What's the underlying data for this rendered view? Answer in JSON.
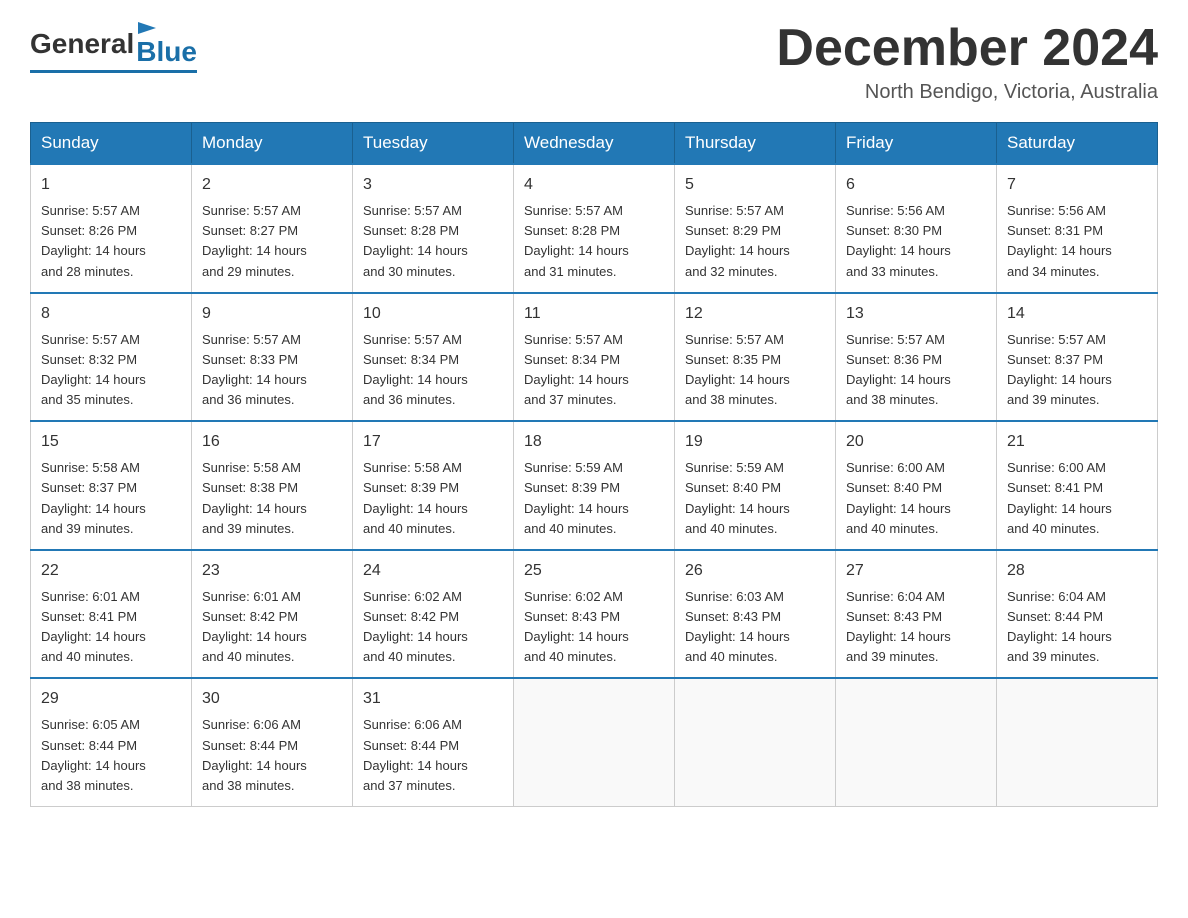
{
  "header": {
    "logo_general": "General",
    "logo_blue": "Blue",
    "month_title": "December 2024",
    "location": "North Bendigo, Victoria, Australia"
  },
  "weekdays": [
    "Sunday",
    "Monday",
    "Tuesday",
    "Wednesday",
    "Thursday",
    "Friday",
    "Saturday"
  ],
  "weeks": [
    [
      {
        "day": "1",
        "sunrise": "5:57 AM",
        "sunset": "8:26 PM",
        "daylight": "14 hours and 28 minutes."
      },
      {
        "day": "2",
        "sunrise": "5:57 AM",
        "sunset": "8:27 PM",
        "daylight": "14 hours and 29 minutes."
      },
      {
        "day": "3",
        "sunrise": "5:57 AM",
        "sunset": "8:28 PM",
        "daylight": "14 hours and 30 minutes."
      },
      {
        "day": "4",
        "sunrise": "5:57 AM",
        "sunset": "8:28 PM",
        "daylight": "14 hours and 31 minutes."
      },
      {
        "day": "5",
        "sunrise": "5:57 AM",
        "sunset": "8:29 PM",
        "daylight": "14 hours and 32 minutes."
      },
      {
        "day": "6",
        "sunrise": "5:56 AM",
        "sunset": "8:30 PM",
        "daylight": "14 hours and 33 minutes."
      },
      {
        "day": "7",
        "sunrise": "5:56 AM",
        "sunset": "8:31 PM",
        "daylight": "14 hours and 34 minutes."
      }
    ],
    [
      {
        "day": "8",
        "sunrise": "5:57 AM",
        "sunset": "8:32 PM",
        "daylight": "14 hours and 35 minutes."
      },
      {
        "day": "9",
        "sunrise": "5:57 AM",
        "sunset": "8:33 PM",
        "daylight": "14 hours and 36 minutes."
      },
      {
        "day": "10",
        "sunrise": "5:57 AM",
        "sunset": "8:34 PM",
        "daylight": "14 hours and 36 minutes."
      },
      {
        "day": "11",
        "sunrise": "5:57 AM",
        "sunset": "8:34 PM",
        "daylight": "14 hours and 37 minutes."
      },
      {
        "day": "12",
        "sunrise": "5:57 AM",
        "sunset": "8:35 PM",
        "daylight": "14 hours and 38 minutes."
      },
      {
        "day": "13",
        "sunrise": "5:57 AM",
        "sunset": "8:36 PM",
        "daylight": "14 hours and 38 minutes."
      },
      {
        "day": "14",
        "sunrise": "5:57 AM",
        "sunset": "8:37 PM",
        "daylight": "14 hours and 39 minutes."
      }
    ],
    [
      {
        "day": "15",
        "sunrise": "5:58 AM",
        "sunset": "8:37 PM",
        "daylight": "14 hours and 39 minutes."
      },
      {
        "day": "16",
        "sunrise": "5:58 AM",
        "sunset": "8:38 PM",
        "daylight": "14 hours and 39 minutes."
      },
      {
        "day": "17",
        "sunrise": "5:58 AM",
        "sunset": "8:39 PM",
        "daylight": "14 hours and 40 minutes."
      },
      {
        "day": "18",
        "sunrise": "5:59 AM",
        "sunset": "8:39 PM",
        "daylight": "14 hours and 40 minutes."
      },
      {
        "day": "19",
        "sunrise": "5:59 AM",
        "sunset": "8:40 PM",
        "daylight": "14 hours and 40 minutes."
      },
      {
        "day": "20",
        "sunrise": "6:00 AM",
        "sunset": "8:40 PM",
        "daylight": "14 hours and 40 minutes."
      },
      {
        "day": "21",
        "sunrise": "6:00 AM",
        "sunset": "8:41 PM",
        "daylight": "14 hours and 40 minutes."
      }
    ],
    [
      {
        "day": "22",
        "sunrise": "6:01 AM",
        "sunset": "8:41 PM",
        "daylight": "14 hours and 40 minutes."
      },
      {
        "day": "23",
        "sunrise": "6:01 AM",
        "sunset": "8:42 PM",
        "daylight": "14 hours and 40 minutes."
      },
      {
        "day": "24",
        "sunrise": "6:02 AM",
        "sunset": "8:42 PM",
        "daylight": "14 hours and 40 minutes."
      },
      {
        "day": "25",
        "sunrise": "6:02 AM",
        "sunset": "8:43 PM",
        "daylight": "14 hours and 40 minutes."
      },
      {
        "day": "26",
        "sunrise": "6:03 AM",
        "sunset": "8:43 PM",
        "daylight": "14 hours and 40 minutes."
      },
      {
        "day": "27",
        "sunrise": "6:04 AM",
        "sunset": "8:43 PM",
        "daylight": "14 hours and 39 minutes."
      },
      {
        "day": "28",
        "sunrise": "6:04 AM",
        "sunset": "8:44 PM",
        "daylight": "14 hours and 39 minutes."
      }
    ],
    [
      {
        "day": "29",
        "sunrise": "6:05 AM",
        "sunset": "8:44 PM",
        "daylight": "14 hours and 38 minutes."
      },
      {
        "day": "30",
        "sunrise": "6:06 AM",
        "sunset": "8:44 PM",
        "daylight": "14 hours and 38 minutes."
      },
      {
        "day": "31",
        "sunrise": "6:06 AM",
        "sunset": "8:44 PM",
        "daylight": "14 hours and 37 minutes."
      },
      null,
      null,
      null,
      null
    ]
  ],
  "labels": {
    "sunrise": "Sunrise:",
    "sunset": "Sunset:",
    "daylight": "Daylight:"
  }
}
